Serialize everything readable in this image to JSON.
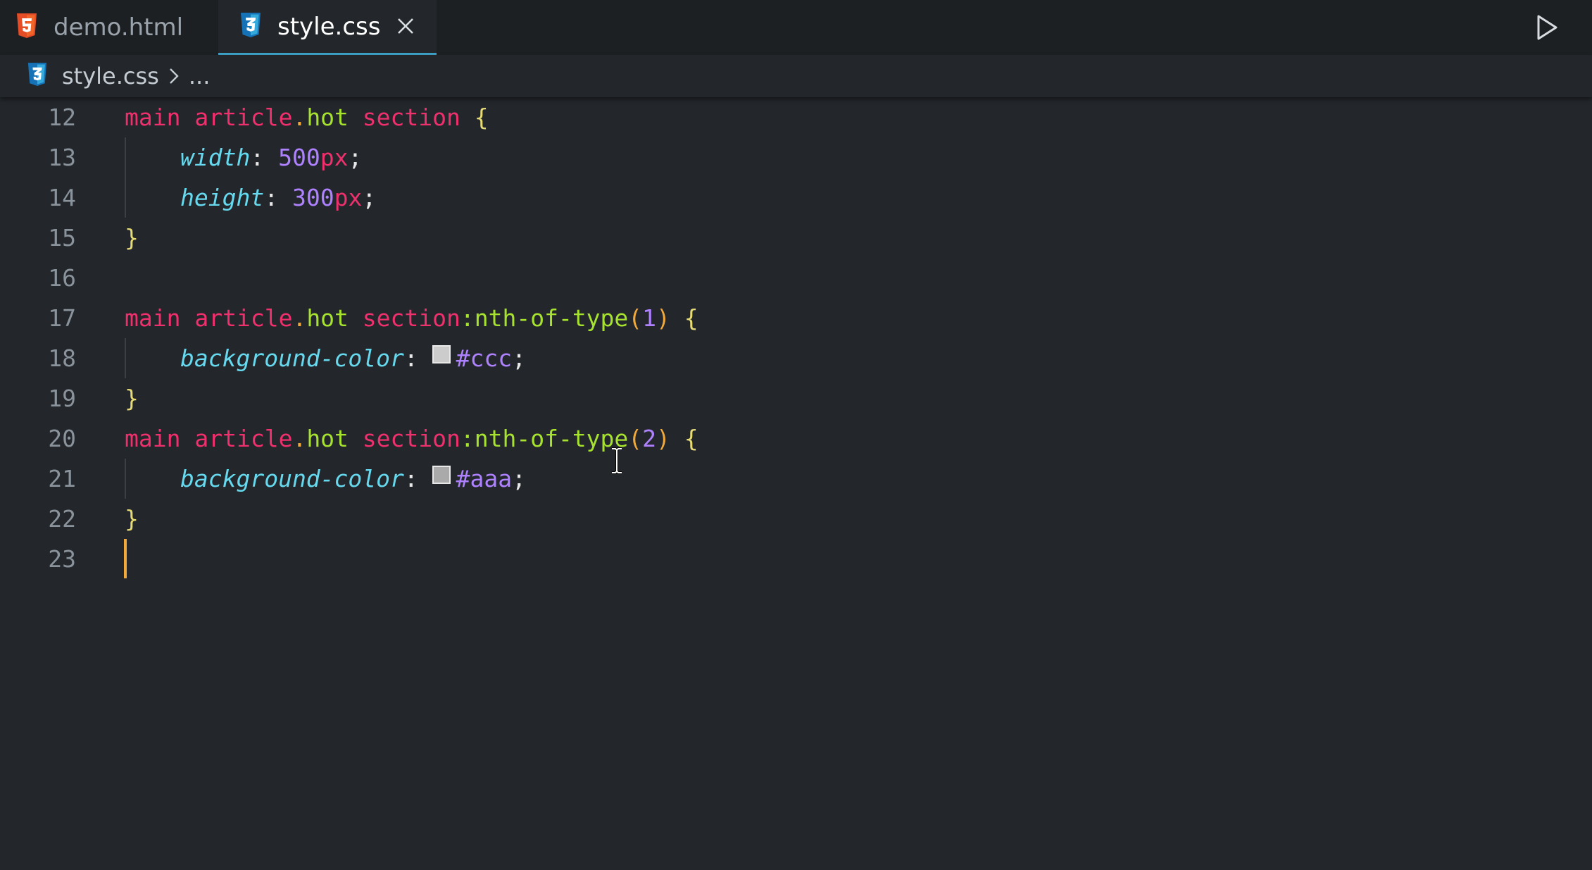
{
  "tabs": [
    {
      "label": "demo.html",
      "icon": "html5-icon",
      "active": false
    },
    {
      "label": "style.css",
      "icon": "css3-icon",
      "active": true
    }
  ],
  "breadcrumb": {
    "file": "style.css",
    "more": "..."
  },
  "colors": {
    "html_icon": "#e44d26",
    "css_icon": "#2f8fd6",
    "active_tab_border": "#3fa3c9",
    "caret": "#f0a93a",
    "swatch_ccc": "#cccccc",
    "swatch_aaa": "#aaaaaa"
  },
  "editor": {
    "lines": [
      {
        "n": "12"
      },
      {
        "n": "13"
      },
      {
        "n": "14"
      },
      {
        "n": "15"
      },
      {
        "n": "16"
      },
      {
        "n": "17"
      },
      {
        "n": "18"
      },
      {
        "n": "19"
      },
      {
        "n": "20"
      },
      {
        "n": "21"
      },
      {
        "n": "22"
      },
      {
        "n": "23"
      }
    ],
    "tokens": {
      "main": "main",
      "article": "article",
      "dot": ".",
      "hot": "hot",
      "section": "section",
      "open_brace": "{",
      "close_brace": "}",
      "width": "width",
      "height": "height",
      "colon": ":",
      "semi": ";",
      "v500": "500",
      "v300": "300",
      "px": "px",
      "pseudo": ":nth-of-type",
      "lparen": "(",
      "rparen": ")",
      "one": "1",
      "two": "2",
      "bgcolor": "background-color",
      "hex_ccc": "#ccc",
      "hex_aaa": "#aaa"
    }
  }
}
